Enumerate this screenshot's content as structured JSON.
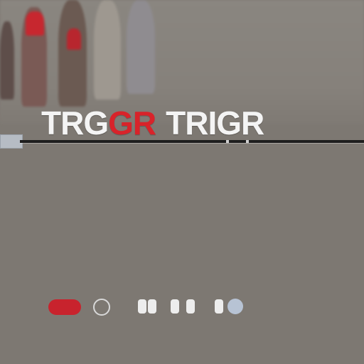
{
  "brand": {
    "word1_prefix": "TRG",
    "word1_accent": "G",
    "word1_suffix_accent": "R",
    "word2": "TRIGR",
    "accent_color": "#d8232a",
    "text_color": "#f4f4f4"
  },
  "hero": {
    "icon": "crowd-photo"
  },
  "timeline": {
    "handle_icon": "scrubber-handle"
  },
  "controls": {
    "items": [
      {
        "icon": "record-pill-icon",
        "color": "#c8232d"
      },
      {
        "icon": "ring-icon"
      },
      {
        "icon": "pause-bar-icon"
      },
      {
        "icon": "pause-bar-icon"
      },
      {
        "icon": "pause-bar-icon"
      },
      {
        "icon": "pause-bar-icon"
      },
      {
        "icon": "pause-bar-icon"
      },
      {
        "icon": "status-dot-icon",
        "color": "#b7c3d4"
      }
    ]
  }
}
